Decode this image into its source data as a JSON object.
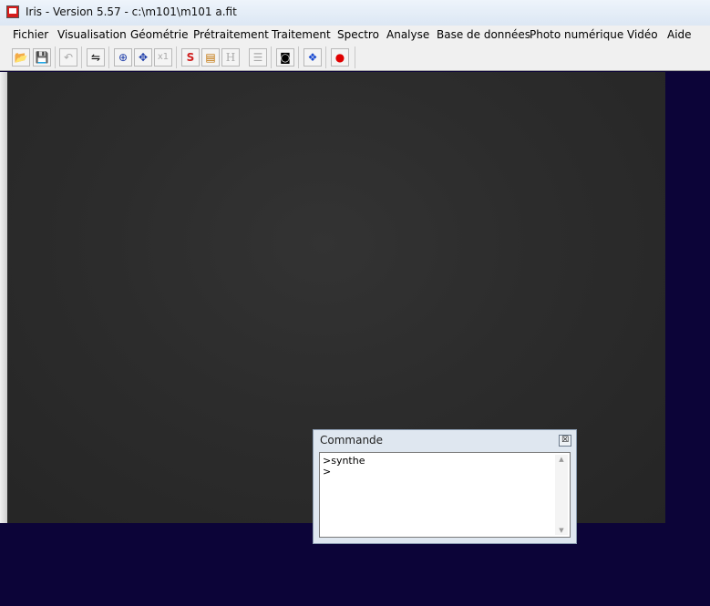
{
  "window": {
    "title": "Iris - Version 5.57 - c:\\m101\\m101 a.fit"
  },
  "menu": [
    "Fichier",
    "Visualisation",
    "Géométrie",
    "Prétraitement",
    "Traitement",
    "Spectro",
    "Analyse",
    "Base de données",
    "Photo numérique",
    "Vidéo",
    "Aide"
  ],
  "toolbar": {
    "buttons": [
      {
        "name": "open-icon",
        "glyph": "📂"
      },
      {
        "name": "save-icon",
        "glyph": "💾"
      },
      {
        "name": "undo-icon",
        "glyph": "↶"
      },
      {
        "name": "threshold-icon",
        "glyph": "⇋"
      },
      {
        "name": "zoom-in-icon",
        "glyph": "⊕"
      },
      {
        "name": "move-icon",
        "glyph": "✥"
      },
      {
        "name": "zoom-x1-icon",
        "glyph": "x1"
      },
      {
        "name": "rgb-icon",
        "glyph": "S"
      },
      {
        "name": "palette-icon",
        "glyph": "▤"
      },
      {
        "name": "histogram-icon",
        "glyph": "H"
      },
      {
        "name": "list-icon",
        "glyph": "☰"
      },
      {
        "name": "camera-icon",
        "glyph": "◙"
      },
      {
        "name": "diamond-icon",
        "glyph": "❖"
      },
      {
        "name": "record-icon",
        "glyph": "●"
      }
    ]
  },
  "command_window": {
    "title": "Commande",
    "close_glyph": "☒",
    "lines": [
      ">synthe",
      ">"
    ]
  },
  "colors": {
    "workspace": "#0c0438",
    "image": "#2c2c2c",
    "record": "#e00000"
  }
}
